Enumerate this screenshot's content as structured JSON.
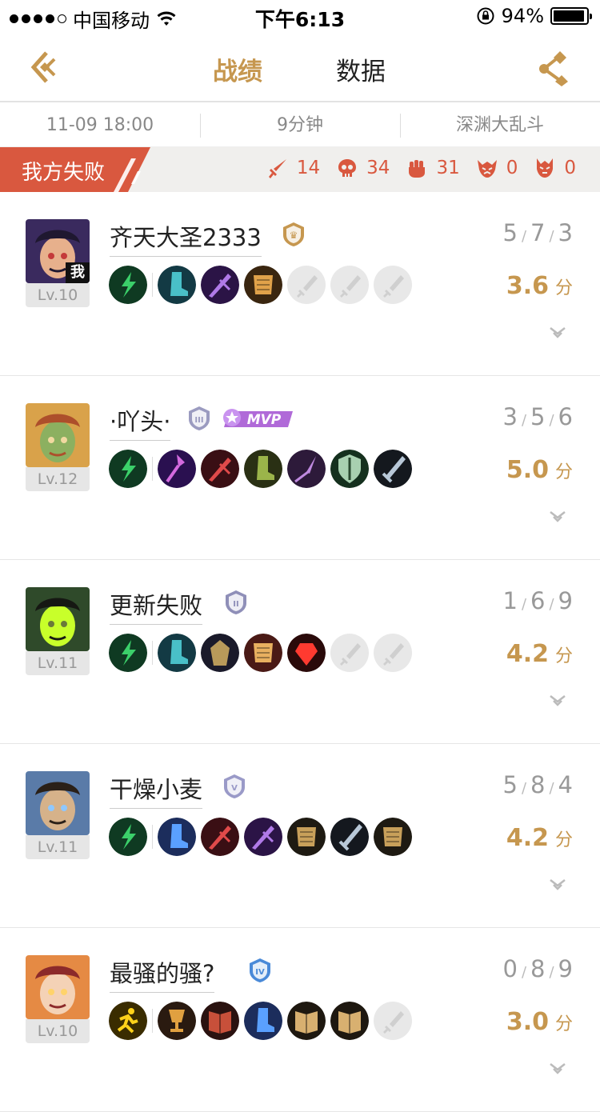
{
  "status_bar": {
    "carrier": "中国移动",
    "time": "下午6:13",
    "battery_percent": "94%",
    "battery_level": 0.94
  },
  "nav": {
    "tab_active": "战绩",
    "tab_inactive": "数据"
  },
  "match_info": {
    "date": "11-09 18:00",
    "duration": "9分钟",
    "mode": "深渊大乱斗"
  },
  "result": {
    "label": "我方失败",
    "stats": [
      {
        "icon": "sword-icon",
        "value": "14"
      },
      {
        "icon": "skull-icon",
        "value": "34"
      },
      {
        "icon": "fist-icon",
        "value": "31"
      },
      {
        "icon": "tyrant-icon",
        "value": "0"
      },
      {
        "icon": "overlord-icon",
        "value": "0"
      }
    ]
  },
  "colors": {
    "accent": "#c6974f",
    "defeat": "#d9583f",
    "mvp": "#b06ad8"
  },
  "players": [
    {
      "name": "齐天大圣2333",
      "level": "Lv.10",
      "me_badge": "我",
      "rank_icon": "rank-king-icon",
      "kda": {
        "k": "5",
        "d": "7",
        "a": "3"
      },
      "score": "3.6",
      "score_unit": "分",
      "items": [
        "green-spell",
        "boots-teal",
        "purple-blade",
        "gold-armor",
        "empty",
        "empty",
        "empty"
      ]
    },
    {
      "name": "·吖头·",
      "level": "Lv.12",
      "rank_icon": "rank-silver-3-icon",
      "mvp": "MVP",
      "kda": {
        "k": "3",
        "d": "5",
        "a": "6"
      },
      "score": "5.0",
      "score_unit": "分",
      "items": [
        "green-spell",
        "purple-staff",
        "red-blade",
        "green-boots",
        "purple-spear",
        "green-shield",
        "dark-sword"
      ]
    },
    {
      "name": "更新失败",
      "level": "Lv.11",
      "rank_icon": "rank-silver-2-icon",
      "kda": {
        "k": "1",
        "d": "6",
        "a": "9"
      },
      "score": "4.2",
      "score_unit": "分",
      "items": [
        "green-spell",
        "boots-teal",
        "dark-cloak",
        "red-gold-armor",
        "red-gem",
        "empty",
        "empty"
      ]
    },
    {
      "name": "干燥小麦",
      "level": "Lv.11",
      "rank_icon": "rank-silver-5-icon",
      "kda": {
        "k": "5",
        "d": "8",
        "a": "4"
      },
      "score": "4.2",
      "score_unit": "分",
      "items": [
        "green-spell",
        "blue-boots",
        "red-blade",
        "purple-blade",
        "gold-armor-dark",
        "dark-sword",
        "gold-armor-dark"
      ]
    },
    {
      "name": "最骚的骚?",
      "level": "Lv.10",
      "rank_icon": "rank-blue-4-icon",
      "kda": {
        "k": "0",
        "d": "8",
        "a": "9"
      },
      "score": "3.0",
      "score_unit": "分",
      "items": [
        "yellow-spell",
        "gold-cup",
        "red-book",
        "blue-boots",
        "gold-book",
        "gold-book",
        "empty"
      ]
    }
  ]
}
